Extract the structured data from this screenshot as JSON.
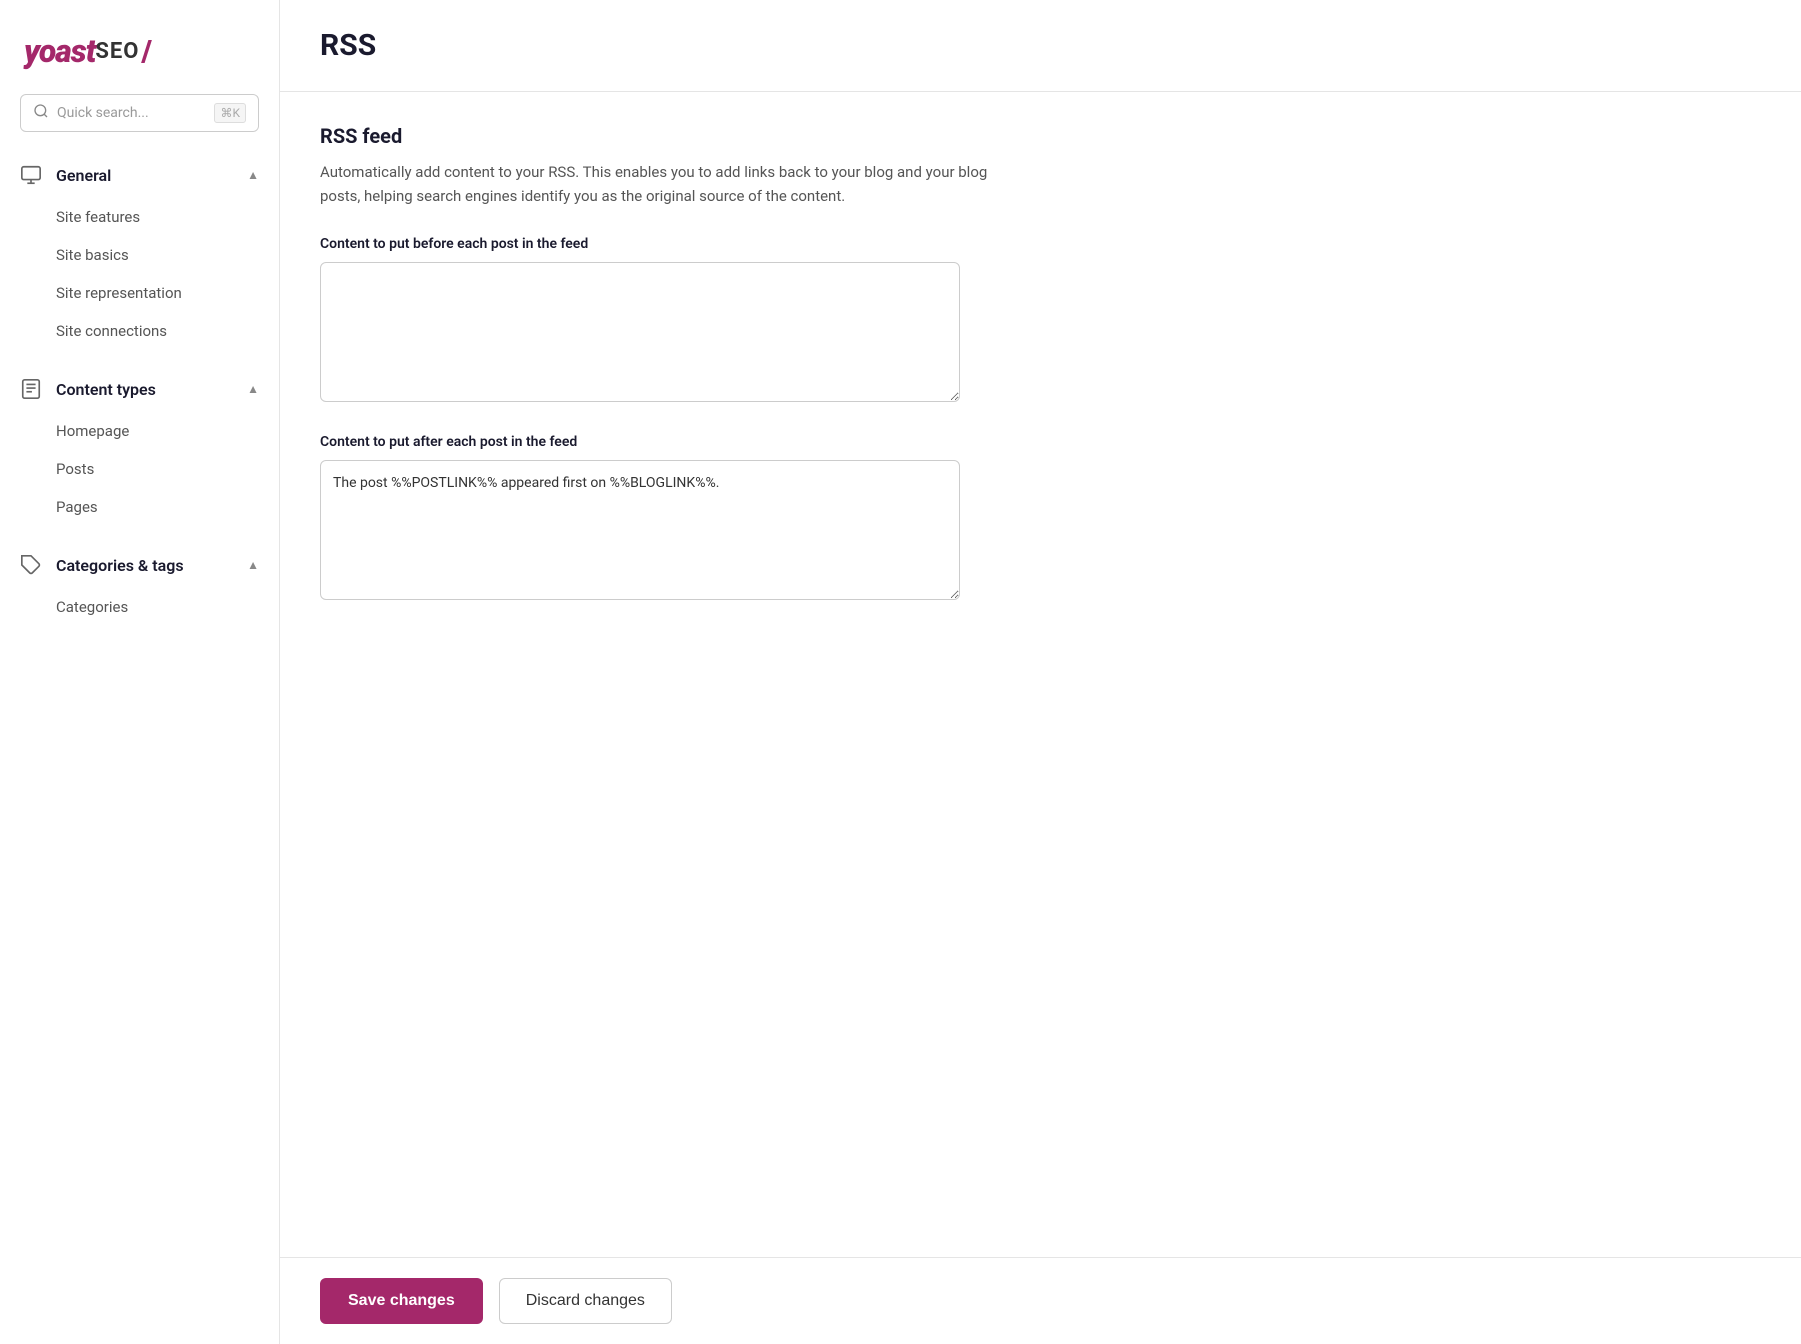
{
  "logo": {
    "yoast": "yoast",
    "seo": "SEO",
    "slash": "/"
  },
  "search": {
    "placeholder": "Quick search...",
    "shortcut": "⌘K"
  },
  "sidebar": {
    "sections": [
      {
        "id": "general",
        "label": "General",
        "icon": "monitor-icon",
        "expanded": true,
        "items": [
          {
            "id": "site-features",
            "label": "Site features"
          },
          {
            "id": "site-basics",
            "label": "Site basics"
          },
          {
            "id": "site-representation",
            "label": "Site representation"
          },
          {
            "id": "site-connections",
            "label": "Site connections"
          }
        ]
      },
      {
        "id": "content-types",
        "label": "Content types",
        "icon": "document-icon",
        "expanded": true,
        "items": [
          {
            "id": "homepage",
            "label": "Homepage"
          },
          {
            "id": "posts",
            "label": "Posts"
          },
          {
            "id": "pages",
            "label": "Pages"
          }
        ]
      },
      {
        "id": "categories-tags",
        "label": "Categories & tags",
        "icon": "tag-icon",
        "expanded": true,
        "items": [
          {
            "id": "categories",
            "label": "Categories"
          }
        ]
      }
    ]
  },
  "page": {
    "title": "RSS",
    "section": {
      "title": "RSS feed",
      "description": "Automatically add content to your RSS. This enables you to add links back to your blog and your blog posts, helping search engines identify you as the original source of the content.",
      "before_label": "Content to put before each post in the feed",
      "before_value": "",
      "after_label": "Content to put after each post in the feed",
      "after_value": "The post %%POSTLINK%% appeared first on %%BLOGLINK%%."
    }
  },
  "footer": {
    "save_label": "Save changes",
    "discard_label": "Discard changes"
  }
}
